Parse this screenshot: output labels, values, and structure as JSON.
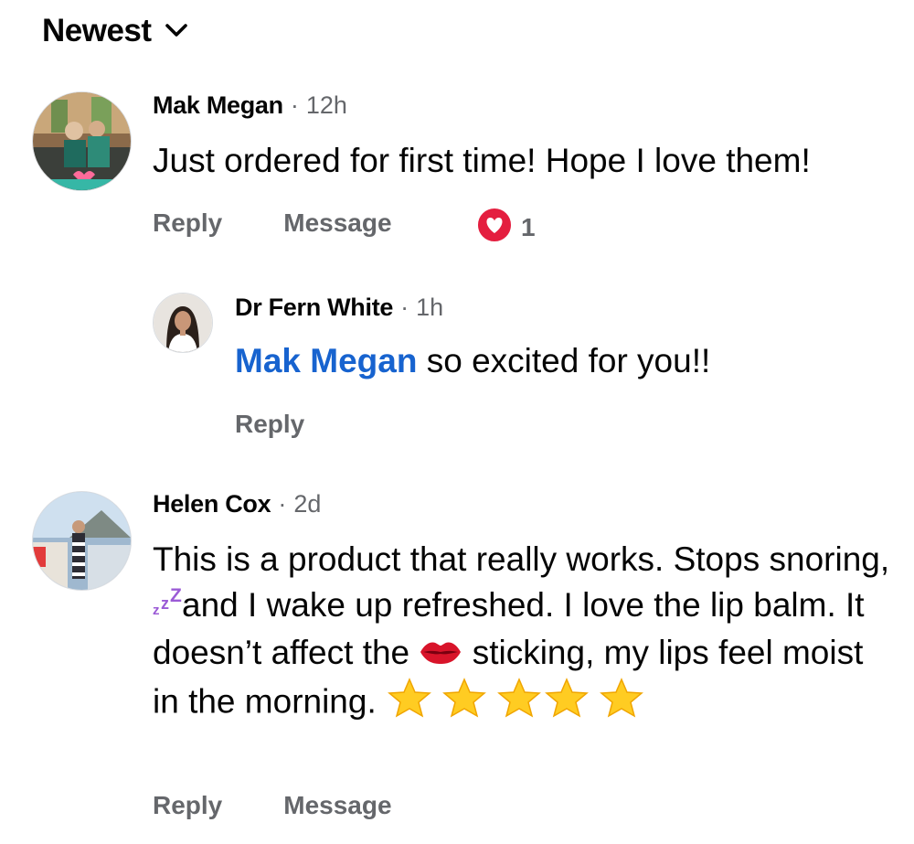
{
  "sort": {
    "label": "Newest",
    "icon": "chevron-down-icon"
  },
  "comments": [
    {
      "author": "Mak Megan",
      "time": "12h",
      "text": "Just ordered for first time! Hope I love them!",
      "actions": [
        "Reply",
        "Message"
      ],
      "reaction": {
        "icon": "heart-icon",
        "count": "1",
        "color": "#e41e3f"
      }
    },
    {
      "author": "Dr Fern White",
      "time": "1h",
      "mention": "Mak Megan",
      "text": " so excited for you!!",
      "actions": [
        "Reply"
      ]
    },
    {
      "author": "Helen Cox",
      "time": "2d",
      "text_parts": [
        "This is a product that really works.  Stops snoring, ",
        "and I wake up refreshed.  I love the lip balm. It doesn’t affect the ",
        " sticking, my lips feel moist in the morning. "
      ],
      "emojis": [
        "zzz-icon",
        "lips-icon",
        "star-icon"
      ],
      "star_count": 5,
      "actions": [
        "Reply",
        "Message"
      ]
    }
  ],
  "colors": {
    "mention": "#1763cf",
    "meta": "#65676b",
    "text": "#050505"
  },
  "dot": "·"
}
